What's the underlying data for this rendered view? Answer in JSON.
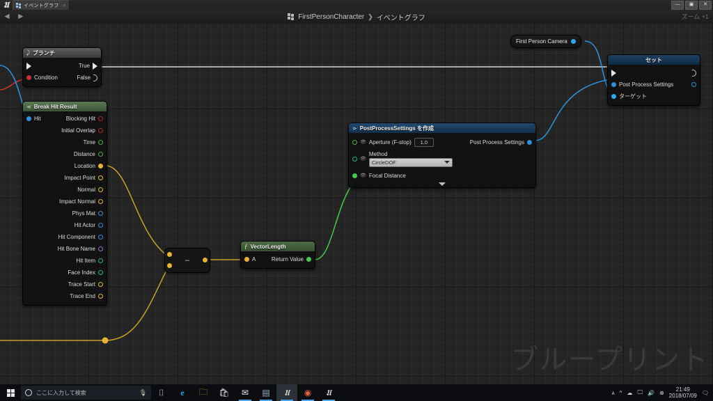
{
  "window": {
    "app_logo": "unreal-logo",
    "tab_label": "イベントグラフ",
    "tab_close": "×",
    "minimize": "—",
    "maximize": "▣",
    "close": "✕"
  },
  "toolbar": {
    "back_arrow": "◄",
    "forward_arrow": "►",
    "breadcrumb_root": "FirstPersonCharacter",
    "breadcrumb_sep": "❯",
    "breadcrumb_current": "イベントグラフ",
    "zoom_label": "ズーム +1"
  },
  "canvas": {
    "watermark": "ブループリント"
  },
  "nodes": {
    "branch": {
      "title": "ブランチ",
      "exec_in": "",
      "condition_label": "Condition",
      "true_label": "True",
      "false_label": "False"
    },
    "break_hit_result": {
      "title": "Break Hit Result",
      "input_label": "Hit",
      "outputs": [
        {
          "label": "Blocking Hit",
          "color": "#b02a2a"
        },
        {
          "label": "Initial Overlap",
          "color": "#b02a2a"
        },
        {
          "label": "Time",
          "color": "#3fae3f"
        },
        {
          "label": "Distance",
          "color": "#3fae3f"
        },
        {
          "label": "Location",
          "color": "#e8b33c"
        },
        {
          "label": "Impact Point",
          "color": "#e8b33c"
        },
        {
          "label": "Normal",
          "color": "#e8b33c"
        },
        {
          "label": "Impact Normal",
          "color": "#e8b33c"
        },
        {
          "label": "Phys Mat",
          "color": "#2f8fd8"
        },
        {
          "label": "Hit Actor",
          "color": "#2f8fd8"
        },
        {
          "label": "Hit Component",
          "color": "#2f8fd8"
        },
        {
          "label": "Hit Bone Name",
          "color": "#a767d8"
        },
        {
          "label": "Hit Item",
          "color": "#23b08a"
        },
        {
          "label": "Face Index",
          "color": "#23b08a"
        },
        {
          "label": "Trace Start",
          "color": "#e8b33c"
        },
        {
          "label": "Trace End",
          "color": "#e8b33c"
        }
      ]
    },
    "subtract": {
      "operator": "–"
    },
    "vector_length": {
      "title": "VectorLength",
      "icon": "ƒ",
      "input_label": "A",
      "output_label": "Return Value"
    },
    "make_pps": {
      "title": "PostProcessSettings を作成",
      "aperture_label": "Aperture (F-stop)",
      "aperture_value": "1.0",
      "method_label": "Method",
      "method_value": "CircleDOF",
      "focal_label": "Focal Distance",
      "output_label": "Post Process Settings",
      "expand_glyph": "▼"
    },
    "first_person_camera": {
      "label": "First Person Camera"
    },
    "set_node": {
      "title": "セット",
      "input_pps": "Post Process Settings",
      "input_target": "ターゲット"
    }
  },
  "taskbar": {
    "start": "windows-logo",
    "search_placeholder": "ここに入力して検索",
    "search_icon": "search-circle-icon",
    "mic_icon": "🎤",
    "items": [
      {
        "name": "task-view-icon",
        "glyph": "⌷"
      },
      {
        "name": "edge-icon",
        "glyph": "e"
      },
      {
        "name": "file-explorer-icon",
        "glyph": "▬"
      },
      {
        "name": "microsoft-store-icon",
        "glyph": "🛍"
      },
      {
        "name": "mail-icon",
        "glyph": "✉"
      },
      {
        "name": "text-editor-icon",
        "glyph": "▤"
      },
      {
        "name": "unreal-editor-icon",
        "glyph": "U"
      },
      {
        "name": "chrome-icon",
        "glyph": "◉"
      },
      {
        "name": "unreal-launcher-icon",
        "glyph": "U"
      }
    ],
    "tray": [
      "ᴀ",
      "^",
      "☁",
      "🖵",
      "🔊",
      "⊗"
    ],
    "clock_time": "21:49",
    "clock_date": "2018/07/09",
    "action_center_icon": "🗨"
  }
}
